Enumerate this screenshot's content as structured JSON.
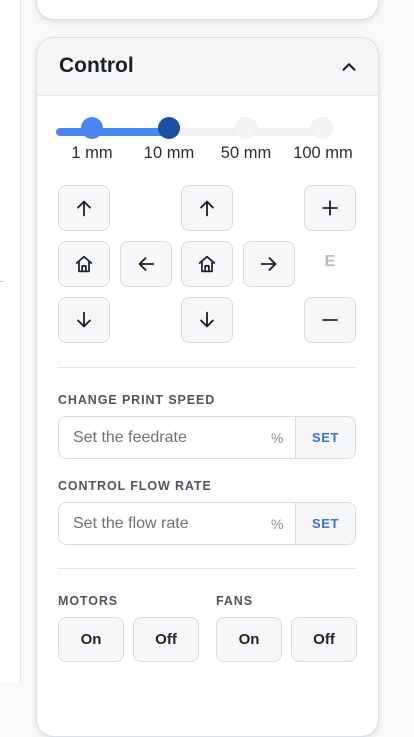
{
  "control": {
    "title": "Control",
    "distance": {
      "options": [
        "1 mm",
        "10 mm",
        "50 mm",
        "100 mm"
      ],
      "selected": "10 mm"
    },
    "extruder_label": "E",
    "print_speed": {
      "label": "CHANGE PRINT SPEED",
      "placeholder": "Set the feedrate",
      "unit": "%",
      "button": "SET"
    },
    "flow_rate": {
      "label": "CONTROL FLOW RATE",
      "placeholder": "Set the flow rate",
      "unit": "%",
      "button": "SET"
    },
    "motors": {
      "label": "MOTORS",
      "on": "On",
      "off": "Off"
    },
    "fans": {
      "label": "FANS",
      "on": "On",
      "off": "Off"
    }
  },
  "colors": {
    "accent": "#4a86f0",
    "accent_dark": "#1b4fa8",
    "set_button_text": "#3b6fd0"
  },
  "icons": {
    "collapse": "chevron-up-icon",
    "up": "arrow-up-icon",
    "down": "arrow-down-icon",
    "left": "arrow-left-icon",
    "right": "arrow-right-icon",
    "home": "home-icon",
    "plus": "plus-icon",
    "minus": "minus-icon"
  }
}
